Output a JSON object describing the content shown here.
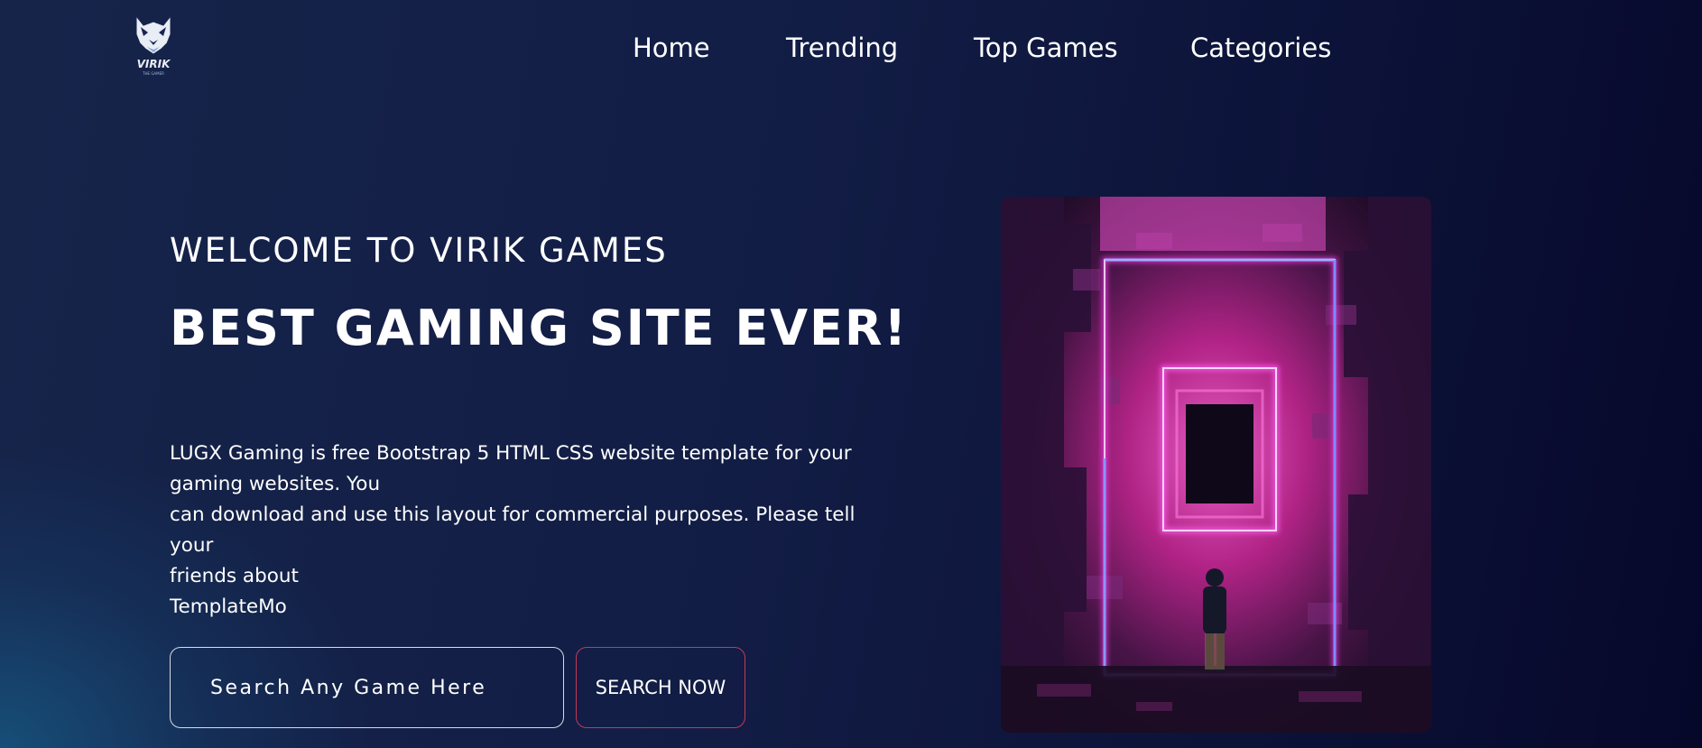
{
  "brand": {
    "logo_name": "VIRIK",
    "logo_tagline": "THE GAMER"
  },
  "nav": {
    "items": [
      {
        "label": "Home"
      },
      {
        "label": "Trending"
      },
      {
        "label": "Top Games"
      },
      {
        "label": "Categories"
      }
    ]
  },
  "hero": {
    "kicker": "WELCOME TO VIRIK GAMES",
    "headline": "BEST GAMING SITE EVER!",
    "description_lines": [
      "LUGX Gaming is free Bootstrap 5 HTML CSS website template for your",
      "gaming websites. You",
      "can download and use this layout for commercial purposes. Please tell your",
      "friends about",
      "TemplateMo"
    ],
    "image_icon": "neon-portal-city-image"
  },
  "search": {
    "placeholder": "Search Any Game Here",
    "button_label": "SEARCH NOW"
  },
  "colors": {
    "accent_border": "#c33a59",
    "input_border": "#d8dbe6",
    "neon_pink": "#ff3df2",
    "neon_blue": "#5a6bff"
  }
}
